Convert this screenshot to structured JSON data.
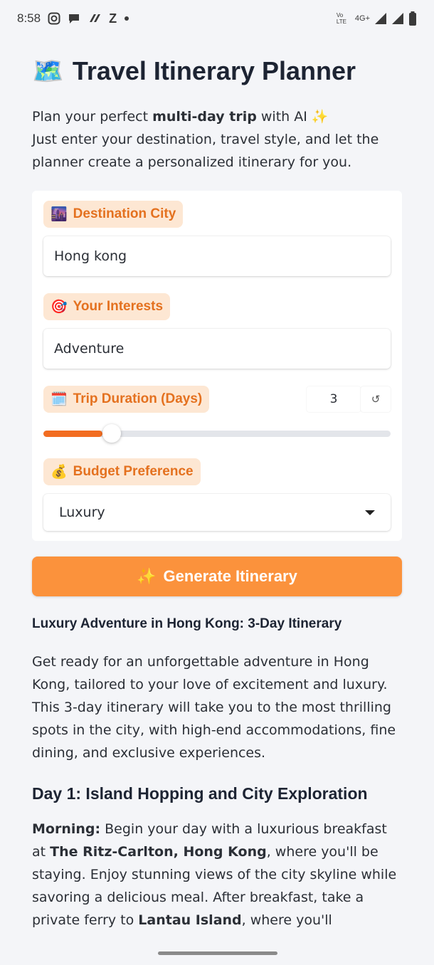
{
  "status_bar": {
    "time": "8:58",
    "network": "4G+",
    "volte": "Vo LTE"
  },
  "app": {
    "title": "Travel Itinerary Planner",
    "title_icon": "world-map-icon",
    "intro_prefix": "Plan your perfect ",
    "intro_bold": "multi-day trip",
    "intro_mid": " with AI ✨",
    "intro_line2": "Just enter your destination, travel style, and let the planner create a personalized itinerary for you."
  },
  "form": {
    "destination": {
      "label": "Destination City",
      "icon": "city-icon",
      "value": "Hong kong"
    },
    "interests": {
      "label": "Your Interests",
      "icon": "target-icon",
      "value": "Adventure"
    },
    "duration": {
      "label": "Trip Duration (Days)",
      "icon": "calendar-icon",
      "value": "3",
      "fraction": 0.171,
      "reset_glyph": "↺"
    },
    "budget": {
      "label": "Budget Preference",
      "icon": "money-bag-icon",
      "value": "Luxury"
    },
    "generate_label": "Generate Itinerary",
    "generate_icon": "sparkles-icon"
  },
  "result": {
    "heading": "Luxury Adventure in Hong Kong: 3-Day Itinerary",
    "intro": "Get ready for an unforgettable adventure in Hong Kong, tailored to your love of excitement and luxury. This 3-day itinerary will take you to the most thrilling spots in the city, with high-end accommodations, fine dining, and exclusive experiences.",
    "day1_heading": "Day 1: Island Hopping and City Exploration",
    "morning_label": "Morning:",
    "morning_text_a": " Begin your day with a luxurious breakfast at ",
    "hotel": "The Ritz-Carlton, Hong Kong",
    "morning_text_b": ", where you'll be staying. Enjoy stunning views of the city skyline while savoring a delicious meal. After breakfast, take a private ferry to ",
    "island": "Lantau Island",
    "morning_text_c": ", where you'll"
  },
  "colors": {
    "accent": "#f26d21",
    "pill_bg": "#fde7d3",
    "pill_text": "#e4711f",
    "button": "#fb923c"
  }
}
